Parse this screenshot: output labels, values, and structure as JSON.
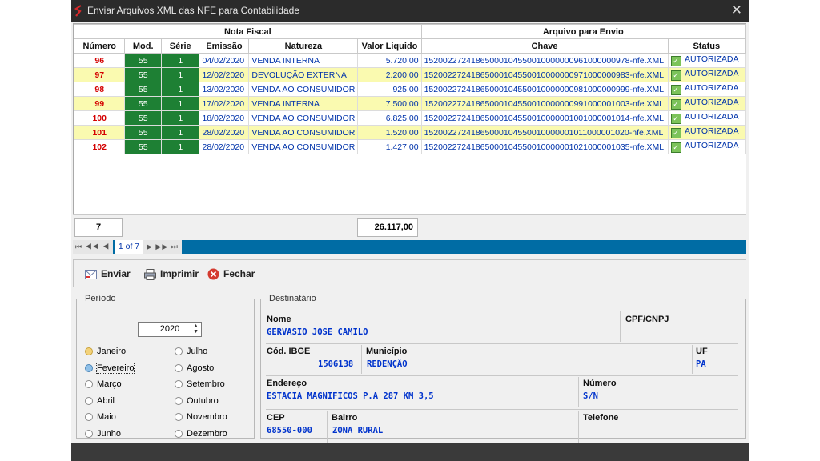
{
  "window": {
    "title": "Enviar Arquivos XML das NFE para Contabilidade",
    "close": "✕"
  },
  "grid": {
    "group_headers": {
      "nota_fiscal": "Nota Fiscal",
      "arquivo": "Arquivo para Envio"
    },
    "columns": [
      "Número",
      "Mod.",
      "Série",
      "Emissão",
      "Natureza",
      "Valor Liquido",
      "Chave",
      "Status"
    ],
    "rows": [
      {
        "numero": "96",
        "mod": "55",
        "serie": "1",
        "emissao": "04/02/2020",
        "natureza": "VENDA INTERNA",
        "valor": "5.720,00",
        "chave": "15200227241865000104550010000000961000000978-nfe.XML",
        "status": "AUTORIZADA"
      },
      {
        "numero": "97",
        "mod": "55",
        "serie": "1",
        "emissao": "12/02/2020",
        "natureza": "DEVOLUÇÃO EXTERNA",
        "valor": "2.200,00",
        "chave": "15200227241865000104550010000000971000000983-nfe.XML",
        "status": "AUTORIZADA"
      },
      {
        "numero": "98",
        "mod": "55",
        "serie": "1",
        "emissao": "13/02/2020",
        "natureza": "VENDA AO CONSUMIDOR",
        "valor": "925,00",
        "chave": "15200227241865000104550010000000981000000999-nfe.XML",
        "status": "AUTORIZADA"
      },
      {
        "numero": "99",
        "mod": "55",
        "serie": "1",
        "emissao": "17/02/2020",
        "natureza": "VENDA INTERNA",
        "valor": "7.500,00",
        "chave": "15200227241865000104550010000000991000001003-nfe.XML",
        "status": "AUTORIZADA"
      },
      {
        "numero": "100",
        "mod": "55",
        "serie": "1",
        "emissao": "18/02/2020",
        "natureza": "VENDA AO CONSUMIDOR",
        "valor": "6.825,00",
        "chave": "15200227241865000104550010000001001000001014-nfe.XML",
        "status": "AUTORIZADA"
      },
      {
        "numero": "101",
        "mod": "55",
        "serie": "1",
        "emissao": "28/02/2020",
        "natureza": "VENDA AO CONSUMIDOR",
        "valor": "1.520,00",
        "chave": "15200227241865000104550010000001011000001020-nfe.XML",
        "status": "AUTORIZADA"
      },
      {
        "numero": "102",
        "mod": "55",
        "serie": "1",
        "emissao": "28/02/2020",
        "natureza": "VENDA AO CONSUMIDOR",
        "valor": "1.427,00",
        "chave": "15200227241865000104550010000001021000001035-nfe.XML",
        "status": "AUTORIZADA"
      }
    ],
    "total_count": "7",
    "total_valor": "26.117,00"
  },
  "navigator": {
    "page_text": "1 of 7",
    "first_prev": "⏮ ◀◀ ◀",
    "next_last": "▶ ▶▶ ⏭"
  },
  "toolbar": {
    "enviar": "Enviar",
    "imprimir": "Imprimir",
    "fechar": "Fechar"
  },
  "periodo": {
    "legend": "Período",
    "year": "2020",
    "months_left": [
      "Janeiro",
      "Fevereiro",
      "Março",
      "Abril",
      "Maio",
      "Junho"
    ],
    "months_right": [
      "Julho",
      "Agosto",
      "Setembro",
      "Outubro",
      "Novembro",
      "Dezembro"
    ],
    "selected": "Fevereiro"
  },
  "destinatario": {
    "legend": "Destinatário",
    "nome_label": "Nome",
    "nome": "GERVASIO JOSE CAMILO",
    "cpf_label": "CPF/CNPJ",
    "cpf": "",
    "ibge_label": "Cód. IBGE",
    "ibge": "1506138",
    "municipio_label": "Município",
    "municipio": "REDENÇÃO",
    "uf_label": "UF",
    "uf": "PA",
    "endereco_label": "Endereço",
    "endereco": "ESTACIA MAGNIFICOS P.A 287 KM 3,5",
    "numero_label": "Número",
    "numero": "S/N",
    "cep_label": "CEP",
    "cep": "68550-000",
    "bairro_label": "Bairro",
    "bairro": "ZONA RURAL",
    "telefone_label": "Telefone",
    "telefone": ""
  }
}
